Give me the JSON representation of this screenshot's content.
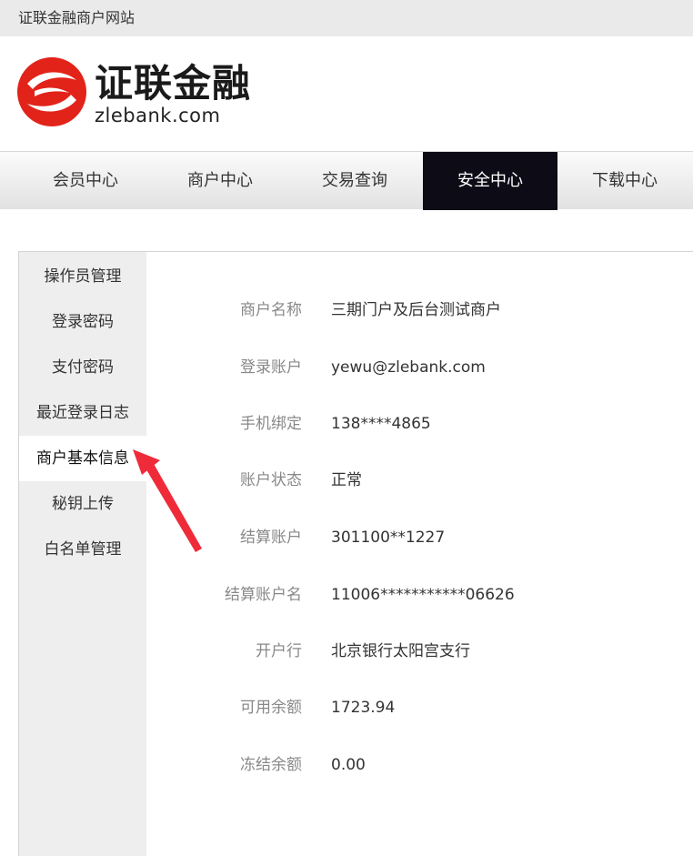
{
  "site_title": "证联金融商户网站",
  "logo": {
    "name_cn": "证联金融",
    "domain_text": "zlebank.com",
    "brand_color": "#e2231a"
  },
  "nav": {
    "items": [
      {
        "label": "会员中心",
        "active": false
      },
      {
        "label": "商户中心",
        "active": false
      },
      {
        "label": "交易查询",
        "active": false
      },
      {
        "label": "安全中心",
        "active": true
      },
      {
        "label": "下载中心",
        "active": false
      }
    ],
    "active_bg": "#0d0b16"
  },
  "sidebar": {
    "items": [
      {
        "label": "操作员管理",
        "active": false
      },
      {
        "label": "登录密码",
        "active": false
      },
      {
        "label": "支付密码",
        "active": false
      },
      {
        "label": "最近登录日志",
        "active": false
      },
      {
        "label": "商户基本信息",
        "active": true
      },
      {
        "label": "秘钥上传",
        "active": false
      },
      {
        "label": "白名单管理",
        "active": false
      }
    ]
  },
  "merchant_info": {
    "rows": [
      {
        "label": "商户名称",
        "value": "三期门户及后台测试商户"
      },
      {
        "label": "登录账户",
        "value": "yewu@zlebank.com"
      },
      {
        "label": "手机绑定",
        "value": "138****4865"
      },
      {
        "label": "账户状态",
        "value": "正常"
      },
      {
        "label": "结算账户",
        "value": "301100**1227"
      },
      {
        "label": "结算账户名",
        "value": "11006***********06626"
      },
      {
        "label": "开户行",
        "value": "北京银行太阳宫支行"
      },
      {
        "label": "可用余额",
        "value": "1723.94"
      },
      {
        "label": "冻结余额",
        "value": "0.00"
      }
    ]
  },
  "annotation": {
    "arrow_color": "#ef2b3a",
    "icon": "red-arrow-icon"
  }
}
